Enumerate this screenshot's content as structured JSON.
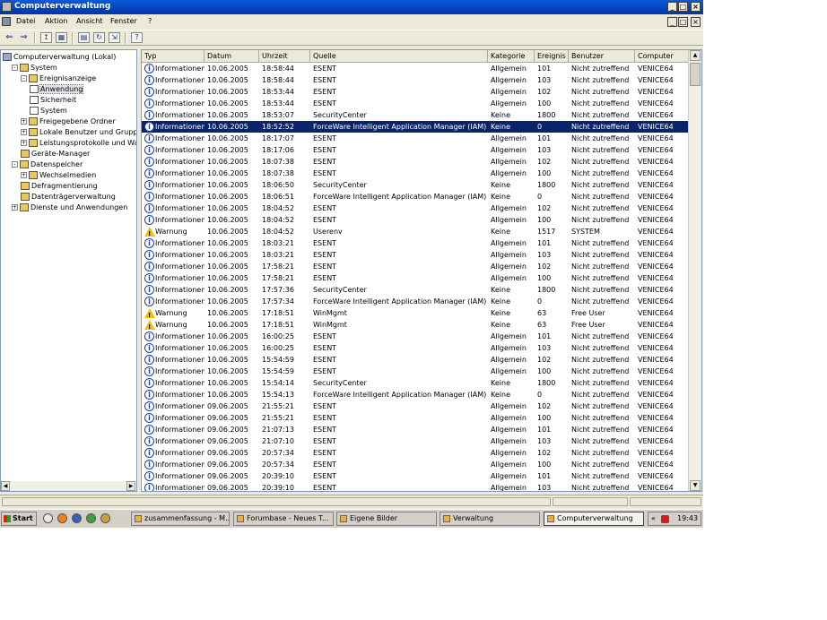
{
  "window": {
    "title": "Computerverwaltung",
    "minimize": "_",
    "restore": "□",
    "close": "×"
  },
  "menu": [
    "Datei",
    "Aktion",
    "Ansicht",
    "Fenster",
    "?"
  ],
  "tree": [
    {
      "label": "Computerverwaltung (Lokal)",
      "icon": "computer-icon",
      "level": 0,
      "expander": ""
    },
    {
      "label": "System",
      "icon": "tools-icon",
      "level": 1,
      "expander": "-"
    },
    {
      "label": "Ereignisanzeige",
      "icon": "event-viewer-icon",
      "level": 2,
      "expander": "-"
    },
    {
      "label": "Anwendung",
      "icon": "log-icon",
      "level": 3,
      "expander": "",
      "selected": true
    },
    {
      "label": "Sicherheit",
      "icon": "log-icon",
      "level": 3,
      "expander": ""
    },
    {
      "label": "System",
      "icon": "log-icon",
      "level": 3,
      "expander": ""
    },
    {
      "label": "Freigegebene Ordner",
      "icon": "folder-icon",
      "level": 2,
      "expander": "+"
    },
    {
      "label": "Lokale Benutzer und Gruppen",
      "icon": "users-icon",
      "level": 2,
      "expander": "+"
    },
    {
      "label": "Leistungsprotokolle und Warnungen",
      "icon": "performance-icon",
      "level": 2,
      "expander": "+"
    },
    {
      "label": "Geräte-Manager",
      "icon": "device-manager-icon",
      "level": 2,
      "expander": ""
    },
    {
      "label": "Datenspeicher",
      "icon": "storage-icon",
      "level": 1,
      "expander": "-"
    },
    {
      "label": "Wechselmedien",
      "icon": "removable-media-icon",
      "level": 2,
      "expander": "+"
    },
    {
      "label": "Defragmentierung",
      "icon": "defrag-icon",
      "level": 2,
      "expander": ""
    },
    {
      "label": "Datenträgerverwaltung",
      "icon": "disk-management-icon",
      "level": 2,
      "expander": ""
    },
    {
      "label": "Dienste und Anwendungen",
      "icon": "services-icon",
      "level": 1,
      "expander": "+"
    }
  ],
  "columns": [
    "Typ",
    "Datum",
    "Uhrzeit",
    "Quelle",
    "Kategorie",
    "Ereignis",
    "Benutzer",
    "Computer"
  ],
  "rows": [
    [
      "Informationen",
      "10.06.2005",
      "18:58:44",
      "ESENT",
      "Allgemein",
      "101",
      "Nicht zutreffend",
      "VENICE64"
    ],
    [
      "Informationen",
      "10.06.2005",
      "18:58:44",
      "ESENT",
      "Allgemein",
      "103",
      "Nicht zutreffend",
      "VENICE64"
    ],
    [
      "Informationen",
      "10.06.2005",
      "18:53:44",
      "ESENT",
      "Allgemein",
      "102",
      "Nicht zutreffend",
      "VENICE64"
    ],
    [
      "Informationen",
      "10.06.2005",
      "18:53:44",
      "ESENT",
      "Allgemein",
      "100",
      "Nicht zutreffend",
      "VENICE64"
    ],
    [
      "Informationen",
      "10.06.2005",
      "18:53:07",
      "SecurityCenter",
      "Keine",
      "1800",
      "Nicht zutreffend",
      "VENICE64"
    ],
    [
      "Informationen",
      "10.06.2005",
      "18:52:52",
      "ForceWare Intelligent Application Manager (IAM)",
      "Keine",
      "0",
      "Nicht zutreffend",
      "VENICE64"
    ],
    [
      "Informationen",
      "10.06.2005",
      "18:17:07",
      "ESENT",
      "Allgemein",
      "101",
      "Nicht zutreffend",
      "VENICE64"
    ],
    [
      "Informationen",
      "10.06.2005",
      "18:17:06",
      "ESENT",
      "Allgemein",
      "103",
      "Nicht zutreffend",
      "VENICE64"
    ],
    [
      "Informationen",
      "10.06.2005",
      "18:07:38",
      "ESENT",
      "Allgemein",
      "102",
      "Nicht zutreffend",
      "VENICE64"
    ],
    [
      "Informationen",
      "10.06.2005",
      "18:07:38",
      "ESENT",
      "Allgemein",
      "100",
      "Nicht zutreffend",
      "VENICE64"
    ],
    [
      "Informationen",
      "10.06.2005",
      "18:06:50",
      "SecurityCenter",
      "Keine",
      "1800",
      "Nicht zutreffend",
      "VENICE64"
    ],
    [
      "Informationen",
      "10.06.2005",
      "18:06:51",
      "ForceWare Intelligent Application Manager (IAM)",
      "Keine",
      "0",
      "Nicht zutreffend",
      "VENICE64"
    ],
    [
      "Informationen",
      "10.06.2005",
      "18:04:52",
      "ESENT",
      "Allgemein",
      "102",
      "Nicht zutreffend",
      "VENICE64"
    ],
    [
      "Informationen",
      "10.06.2005",
      "18:04:52",
      "ESENT",
      "Allgemein",
      "100",
      "Nicht zutreffend",
      "VENICE64"
    ],
    [
      "Warnung",
      "10.06.2005",
      "18:04:52",
      "Userenv",
      "Keine",
      "1517",
      "SYSTEM",
      "VENICE64"
    ],
    [
      "Informationen",
      "10.06.2005",
      "18:03:21",
      "ESENT",
      "Allgemein",
      "101",
      "Nicht zutreffend",
      "VENICE64"
    ],
    [
      "Informationen",
      "10.06.2005",
      "18:03:21",
      "ESENT",
      "Allgemein",
      "103",
      "Nicht zutreffend",
      "VENICE64"
    ],
    [
      "Informationen",
      "10.06.2005",
      "17:58:21",
      "ESENT",
      "Allgemein",
      "102",
      "Nicht zutreffend",
      "VENICE64"
    ],
    [
      "Informationen",
      "10.06.2005",
      "17:58:21",
      "ESENT",
      "Allgemein",
      "100",
      "Nicht zutreffend",
      "VENICE64"
    ],
    [
      "Informationen",
      "10.06.2005",
      "17:57:36",
      "SecurityCenter",
      "Keine",
      "1800",
      "Nicht zutreffend",
      "VENICE64"
    ],
    [
      "Informationen",
      "10.06.2005",
      "17:57:34",
      "ForceWare Intelligent Application Manager (IAM)",
      "Keine",
      "0",
      "Nicht zutreffend",
      "VENICE64"
    ],
    [
      "Warnung",
      "10.06.2005",
      "17:18:51",
      "WinMgmt",
      "Keine",
      "63",
      "Free User",
      "VENICE64"
    ],
    [
      "Warnung",
      "10.06.2005",
      "17:18:51",
      "WinMgmt",
      "Keine",
      "63",
      "Free User",
      "VENICE64"
    ],
    [
      "Informationen",
      "10.06.2005",
      "16:00:25",
      "ESENT",
      "Allgemein",
      "101",
      "Nicht zutreffend",
      "VENICE64"
    ],
    [
      "Informationen",
      "10.06.2005",
      "16:00:25",
      "ESENT",
      "Allgemein",
      "103",
      "Nicht zutreffend",
      "VENICE64"
    ],
    [
      "Informationen",
      "10.06.2005",
      "15:54:59",
      "ESENT",
      "Allgemein",
      "102",
      "Nicht zutreffend",
      "VENICE64"
    ],
    [
      "Informationen",
      "10.06.2005",
      "15:54:59",
      "ESENT",
      "Allgemein",
      "100",
      "Nicht zutreffend",
      "VENICE64"
    ],
    [
      "Informationen",
      "10.06.2005",
      "15:54:14",
      "SecurityCenter",
      "Keine",
      "1800",
      "Nicht zutreffend",
      "VENICE64"
    ],
    [
      "Informationen",
      "10.06.2005",
      "15:54:13",
      "ForceWare Intelligent Application Manager (IAM)",
      "Keine",
      "0",
      "Nicht zutreffend",
      "VENICE64"
    ],
    [
      "Informationen",
      "09.06.2005",
      "21:55:21",
      "ESENT",
      "Allgemein",
      "102",
      "Nicht zutreffend",
      "VENICE64"
    ],
    [
      "Informationen",
      "09.06.2005",
      "21:55:21",
      "ESENT",
      "Allgemein",
      "100",
      "Nicht zutreffend",
      "VENICE64"
    ],
    [
      "Informationen",
      "09.06.2005",
      "21:07:13",
      "ESENT",
      "Allgemein",
      "101",
      "Nicht zutreffend",
      "VENICE64"
    ],
    [
      "Informationen",
      "09.06.2005",
      "21:07:10",
      "ESENT",
      "Allgemein",
      "103",
      "Nicht zutreffend",
      "VENICE64"
    ],
    [
      "Informationen",
      "09.06.2005",
      "20:57:34",
      "ESENT",
      "Allgemein",
      "102",
      "Nicht zutreffend",
      "VENICE64"
    ],
    [
      "Informationen",
      "09.06.2005",
      "20:57:34",
      "ESENT",
      "Allgemein",
      "100",
      "Nicht zutreffend",
      "VENICE64"
    ],
    [
      "Informationen",
      "09.06.2005",
      "20:39:10",
      "ESENT",
      "Allgemein",
      "101",
      "Nicht zutreffend",
      "VENICE64"
    ],
    [
      "Informationen",
      "09.06.2005",
      "20:39:10",
      "ESENT",
      "Allgemein",
      "103",
      "Nicht zutreffend",
      "VENICE64"
    ]
  ],
  "selected_row": 5,
  "taskbar": {
    "start": "Start",
    "tasks": [
      {
        "label": "zusammenfassung - M...",
        "active": false
      },
      {
        "label": "Forumbase - Neues T...",
        "active": false
      },
      {
        "label": "Eigene Bilder",
        "active": false
      },
      {
        "label": "Verwaltung",
        "active": false
      },
      {
        "label": "Computerverwaltung",
        "active": true
      }
    ],
    "clock": "19:43",
    "tray_chevron": "«"
  },
  "colors": {
    "selection": "#0a246a",
    "titlebar": "#0a5ad8",
    "face": "#ece9d8"
  }
}
